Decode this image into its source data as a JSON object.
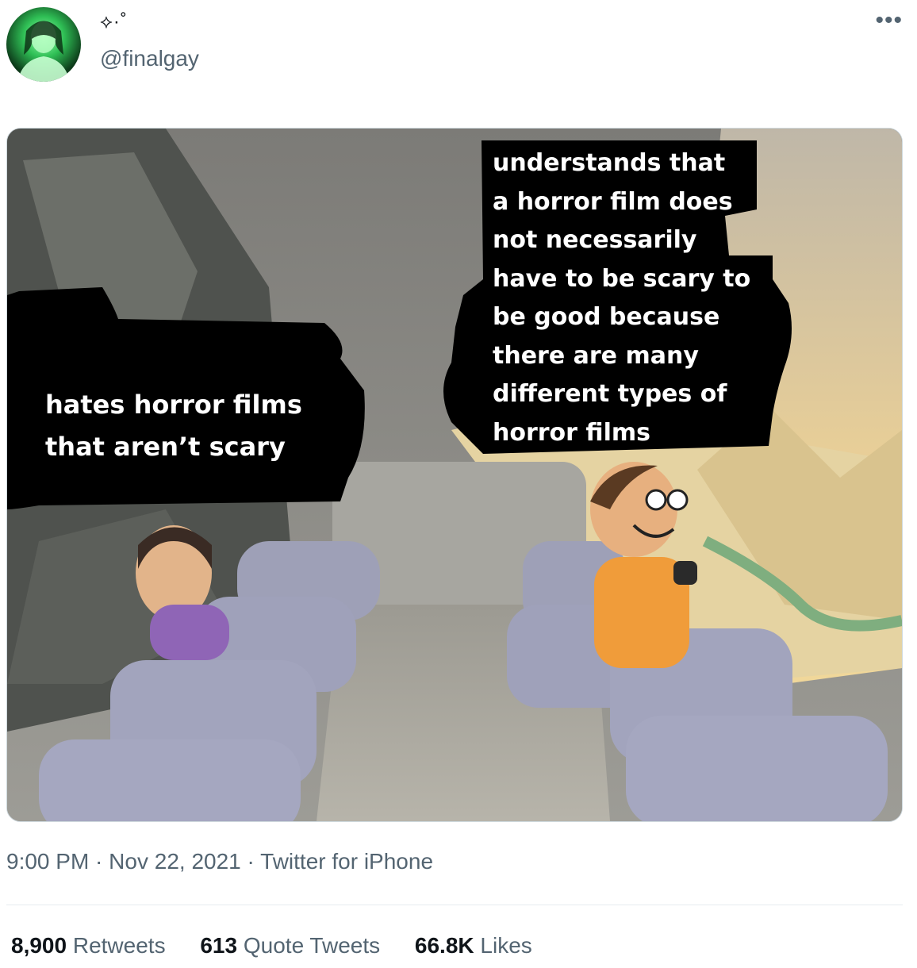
{
  "user": {
    "display_name": "⟡·˚",
    "handle": "@finalgay"
  },
  "more_icon": "more-icon",
  "meme": {
    "left_caption_lines": [
      "hates horror films",
      "that aren’t scary"
    ],
    "right_caption_lines": [
      "understands that",
      "a horror film does",
      "not necessarily",
      "have to be scary to",
      "be good because",
      "there are many",
      "different types of",
      "horror films"
    ]
  },
  "meta": {
    "time": "9:00 PM",
    "sep1": " · ",
    "date": "Nov 22, 2021",
    "sep2": " · ",
    "source": "Twitter for iPhone"
  },
  "stats": {
    "retweets": "8,900",
    "retweets_label": "Retweets",
    "quotes": "613",
    "quotes_label": "Quote Tweets",
    "likes": "66.8K",
    "likes_label": "Likes"
  },
  "colors": {
    "text": "#0f1419",
    "secondary": "#536471",
    "border": "#cfd9de"
  }
}
